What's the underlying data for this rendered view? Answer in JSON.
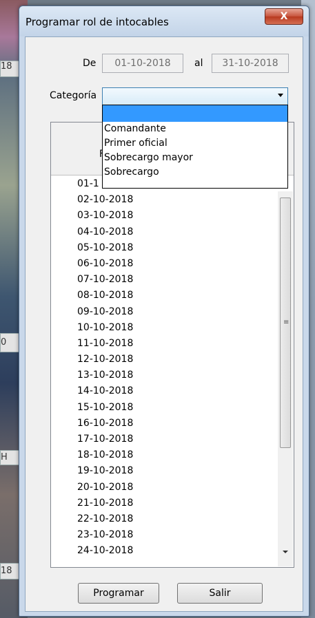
{
  "window": {
    "title": "Programar rol de intocables",
    "close_label": "X"
  },
  "dates": {
    "from_label": "De",
    "from_value": "01-10-2018",
    "to_label": "al",
    "to_value": "31-10-2018"
  },
  "category": {
    "label": "Categoría",
    "selected": "",
    "options": [
      "",
      "Comandante",
      "Primer oficial",
      "Sobrecargo mayor",
      "Sobrecargo"
    ]
  },
  "grid": {
    "header": "Fe",
    "rows": [
      "01-1",
      "02-10-2018",
      "03-10-2018",
      "04-10-2018",
      "05-10-2018",
      "06-10-2018",
      "07-10-2018",
      "08-10-2018",
      "09-10-2018",
      "10-10-2018",
      "11-10-2018",
      "12-10-2018",
      "13-10-2018",
      "14-10-2018",
      "15-10-2018",
      "16-10-2018",
      "17-10-2018",
      "18-10-2018",
      "19-10-2018",
      "20-10-2018",
      "21-10-2018",
      "22-10-2018",
      "23-10-2018",
      "24-10-2018"
    ]
  },
  "buttons": {
    "program": "Programar",
    "exit": "Salir"
  },
  "background_fragments": [
    "18",
    "0",
    "H",
    "18"
  ]
}
